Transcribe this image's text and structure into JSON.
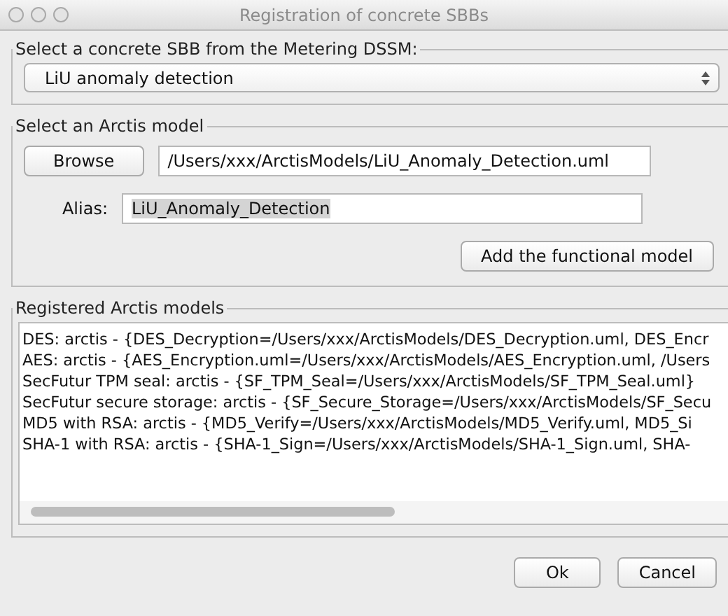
{
  "window": {
    "title": "Registration of concrete SBBs"
  },
  "sbb_group": {
    "title": "Select a concrete SBB from the Metering DSSM:",
    "dropdown": {
      "value": "LiU anomaly detection"
    }
  },
  "model_group": {
    "title": "Select an Arctis model",
    "browse_button": "Browse",
    "path_field": {
      "value": "/Users/xxx/ArctisModels/LiU_Anomaly_Detection.uml"
    },
    "alias_label": "Alias:",
    "alias_field": {
      "value": "LiU_Anomaly_Detection"
    },
    "add_button": "Add the functional model"
  },
  "registered_group": {
    "title": "Registered Arctis models",
    "rows": [
      "DES: arctis - {DES_Decryption=/Users/xxx/ArctisModels/DES_Decryption.uml, DES_Encr",
      "AES: arctis - {AES_Encryption.uml=/Users/xxx/ArctisModels/AES_Encryption.uml, /Users",
      "SecFutur TPM seal: arctis - {SF_TPM_Seal=/Users/xxx/ArctisModels/SF_TPM_Seal.uml}",
      "SecFutur secure storage: arctis - {SF_Secure_Storage=/Users/xxx/ArctisModels/SF_Secu",
      "MD5 with RSA: arctis - {MD5_Verify=/Users/xxx/ArctisModels/MD5_Verify.uml, MD5_Si",
      "SHA-1 with RSA: arctis - {SHA-1_Sign=/Users/xxx/ArctisModels/SHA-1_Sign.uml, SHA-"
    ]
  },
  "buttons": [
    {
      "label": "Ok"
    },
    {
      "label": "Cancel"
    }
  ]
}
